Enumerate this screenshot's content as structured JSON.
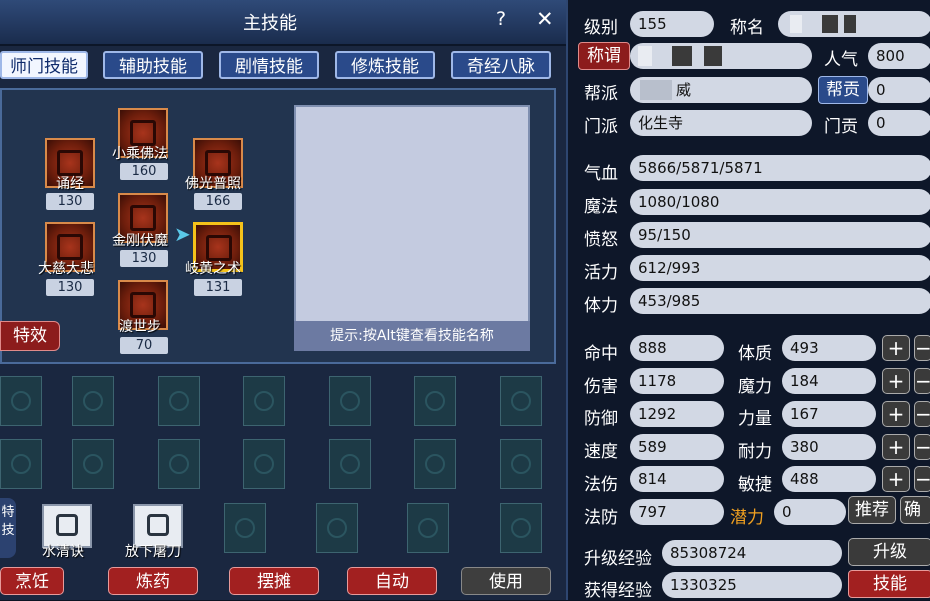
{
  "window": {
    "title": "主技能",
    "help": "?",
    "close": "✕"
  },
  "tabs": [
    "师门技能",
    "辅助技能",
    "剧情技能",
    "修炼技能",
    "奇经八脉"
  ],
  "skills": [
    {
      "name": "小乘佛法",
      "level": "160"
    },
    {
      "name": "诵经",
      "level": "130"
    },
    {
      "name": "佛光普照",
      "level": "166"
    },
    {
      "name": "金刚伏魔",
      "level": "130"
    },
    {
      "name": "大慈大悲",
      "level": "130"
    },
    {
      "name": "岐黄之术",
      "level": "131"
    },
    {
      "name": "渡世步",
      "level": "70"
    }
  ],
  "special_button": "特效",
  "hint": "提示:按Alt键查看技能名称",
  "special_tab": "特技",
  "special_skills": [
    "水清诀",
    "放下屠刀"
  ],
  "bottom_buttons": [
    "烹饪",
    "炼药",
    "摆摊",
    "自动",
    "使用"
  ],
  "character": {
    "level_label": "级别",
    "level": "155",
    "name_label": "称名",
    "title_button": "称谓",
    "popularity_label": "人气",
    "popularity": "800",
    "gang_label": "帮派",
    "gang": "威",
    "gang_contribution_label": "帮贡",
    "gang_contribution": "0",
    "sect_label": "门派",
    "sect": "化生寺",
    "sect_contribution_label": "门贡",
    "sect_contribution": "0"
  },
  "vitals": [
    {
      "label": "气血",
      "value": "5866/5871/5871"
    },
    {
      "label": "魔法",
      "value": "1080/1080"
    },
    {
      "label": "愤怒",
      "value": "95/150"
    },
    {
      "label": "活力",
      "value": "612/993"
    },
    {
      "label": "体力",
      "value": "453/985"
    }
  ],
  "combat": [
    {
      "label": "命中",
      "value": "888"
    },
    {
      "label": "伤害",
      "value": "1178"
    },
    {
      "label": "防御",
      "value": "1292"
    },
    {
      "label": "速度",
      "value": "589"
    },
    {
      "label": "法伤",
      "value": "814"
    },
    {
      "label": "法防",
      "value": "797"
    }
  ],
  "attributes": [
    {
      "label": "体质",
      "value": "493"
    },
    {
      "label": "魔力",
      "value": "184"
    },
    {
      "label": "力量",
      "value": "167"
    },
    {
      "label": "耐力",
      "value": "380"
    },
    {
      "label": "敏捷",
      "value": "488"
    }
  ],
  "potential": {
    "label": "潜力",
    "value": "0",
    "recommend": "推荐",
    "confirm": "确认"
  },
  "experience": {
    "upgrade_label": "升级经验",
    "upgrade_value": "85308724",
    "upgrade_button": "升级",
    "gained_label": "获得经验",
    "gained_value": "1330325",
    "skill_button": "技能"
  },
  "colors": {
    "accent_red": "#a22020",
    "potential_orange": "#f0a020",
    "blue_button": "#2a4a8a"
  }
}
